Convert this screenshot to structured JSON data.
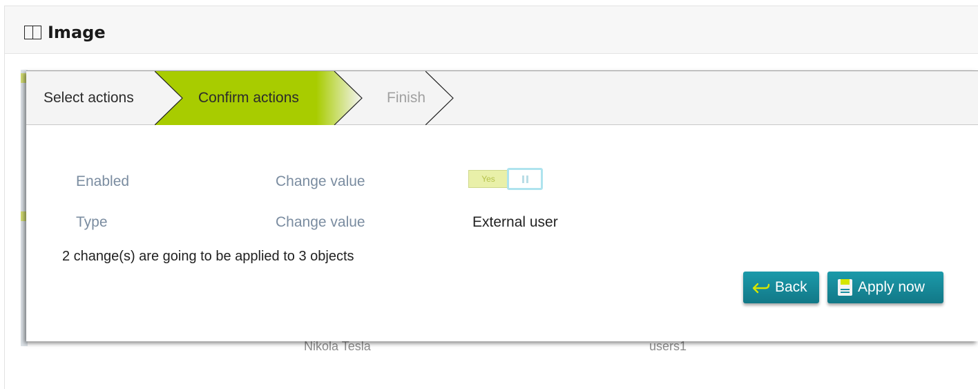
{
  "panel": {
    "title": "Image",
    "icon": "image-icon"
  },
  "wizard": {
    "steps": [
      {
        "label": "Select actions",
        "state": "done"
      },
      {
        "label": "Confirm actions",
        "state": "active"
      },
      {
        "label": "Finish",
        "state": "pending"
      }
    ],
    "active_color": "#a8cc00"
  },
  "changes": [
    {
      "field": "Enabled",
      "action": "Change value",
      "value": "Yes"
    },
    {
      "field": "Type",
      "action": "Change value",
      "value": "External user"
    }
  ],
  "summary": "2 change(s) are going to be applied to 3 objects",
  "buttons": {
    "back": {
      "label": "Back",
      "icon": "back-arrow-icon"
    },
    "apply": {
      "label": "Apply now",
      "icon": "save-icon"
    }
  },
  "background": {
    "row_left": "Nikola Tesla",
    "row_right": "users1"
  },
  "colors": {
    "button": "#1a8fa0",
    "label": "#7a8ca0",
    "toggle_on": "#e9f0a9"
  }
}
